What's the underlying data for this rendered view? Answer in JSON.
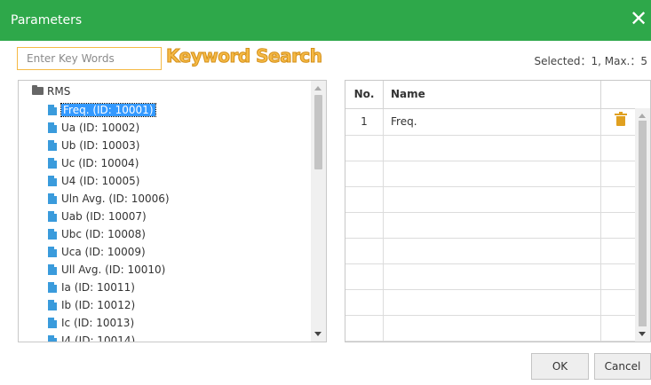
{
  "dialog": {
    "title": "Parameters",
    "close_glyph": "✕"
  },
  "search": {
    "placeholder": "Enter Key Words",
    "hint_label": "Keyword Search"
  },
  "selection": {
    "info": "Selected：1, Max.：5"
  },
  "tree": {
    "root_label": "RMS",
    "items": [
      {
        "label": "Freq. (ID: 10001)",
        "selected": true
      },
      {
        "label": "Ua (ID: 10002)"
      },
      {
        "label": "Ub (ID: 10003)"
      },
      {
        "label": "Uc (ID: 10004)"
      },
      {
        "label": "U4 (ID: 10005)"
      },
      {
        "label": "Uln Avg. (ID: 10006)"
      },
      {
        "label": "Uab (ID: 10007)"
      },
      {
        "label": "Ubc (ID: 10008)"
      },
      {
        "label": "Uca (ID: 10009)"
      },
      {
        "label": "Ull Avg. (ID: 10010)"
      },
      {
        "label": "Ia (ID: 10011)"
      },
      {
        "label": "Ib (ID: 10012)"
      },
      {
        "label": "Ic (ID: 10013)"
      },
      {
        "label": "I4 (ID: 10014)"
      }
    ]
  },
  "grid": {
    "col_no": "No.",
    "col_name": "Name",
    "rows": [
      {
        "no": "1",
        "name": "Freq."
      },
      {
        "no": "",
        "name": ""
      },
      {
        "no": "",
        "name": ""
      },
      {
        "no": "",
        "name": ""
      },
      {
        "no": "",
        "name": ""
      },
      {
        "no": "",
        "name": ""
      },
      {
        "no": "",
        "name": ""
      },
      {
        "no": "",
        "name": ""
      },
      {
        "no": "",
        "name": ""
      }
    ]
  },
  "buttons": {
    "ok": "OK",
    "cancel": "Cancel"
  },
  "icons": {
    "close": "close-icon",
    "folder": "folder-icon",
    "file": "file-icon",
    "trash": "trash-icon"
  },
  "colors": {
    "titlebar": "#2ea84a",
    "accent": "#f5b945",
    "selection": "#3399ff",
    "file_icon": "#3a9bdc",
    "trash_icon": "#e0a020"
  }
}
